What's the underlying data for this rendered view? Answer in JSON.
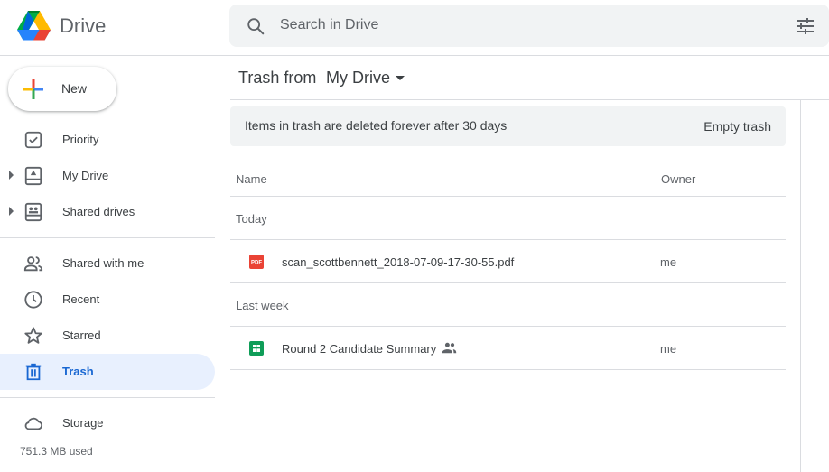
{
  "app": {
    "name": "Drive"
  },
  "search": {
    "placeholder": "Search in Drive",
    "icon": "search-icon",
    "options_icon": "tune-icon"
  },
  "sidebar": {
    "new_label": "New",
    "items": [
      {
        "label": "Priority",
        "icon": "priority-check-icon"
      },
      {
        "label": "My Drive",
        "icon": "my-drive-icon"
      },
      {
        "label": "Shared drives",
        "icon": "shared-drives-icon"
      },
      {
        "label": "Shared with me",
        "icon": "people-icon"
      },
      {
        "label": "Recent",
        "icon": "clock-icon"
      },
      {
        "label": "Starred",
        "icon": "star-icon"
      },
      {
        "label": "Trash",
        "icon": "trash-icon",
        "active": true
      }
    ],
    "storage": {
      "label": "Storage",
      "used": "751.3 MB used",
      "icon": "cloud-icon"
    }
  },
  "main": {
    "title_prefix": "Trash from",
    "title_location": "My Drive",
    "banner": {
      "text": "Items in trash are deleted forever after 30 days",
      "button": "Empty trash"
    },
    "columns": {
      "name": "Name",
      "owner": "Owner"
    },
    "groups": [
      {
        "label": "Today",
        "files": [
          {
            "name": "scan_scottbennett_2018-07-09-17-30-55.pdf",
            "owner": "me",
            "type": "pdf",
            "icon_text": "PDF",
            "shared": false
          }
        ]
      },
      {
        "label": "Last week",
        "files": [
          {
            "name": "Round 2 Candidate Summary",
            "owner": "me",
            "type": "sheets",
            "shared": true
          }
        ]
      }
    ]
  },
  "colors": {
    "accent": "#1967d2",
    "active_bg": "#e8f0fe",
    "pdf": "#ea4335",
    "sheets": "#0f9d58"
  }
}
